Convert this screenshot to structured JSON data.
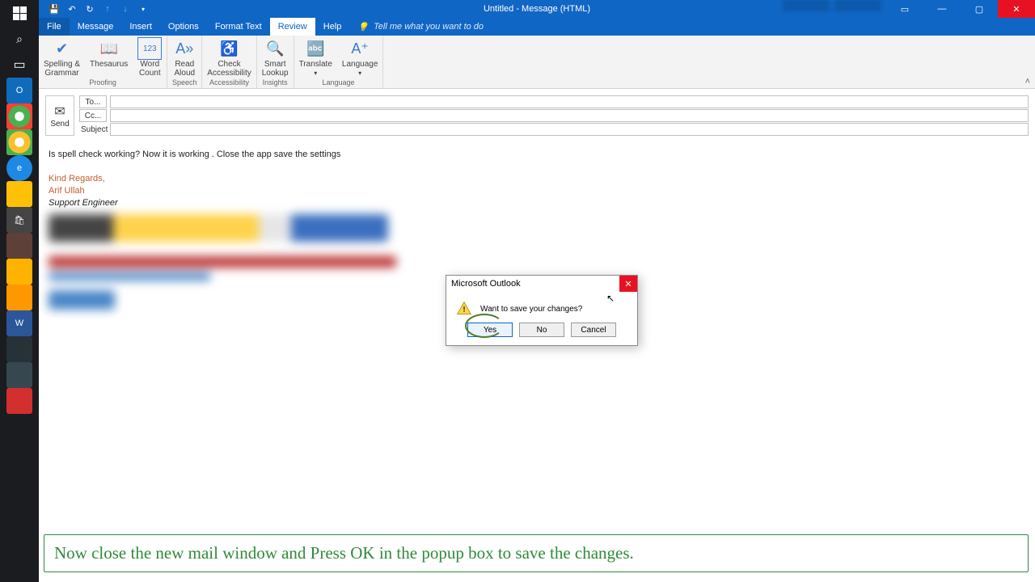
{
  "window": {
    "title": "Untitled  -  Message (HTML)"
  },
  "tabs": {
    "file": "File",
    "message": "Message",
    "insert": "Insert",
    "options": "Options",
    "formatText": "Format Text",
    "review": "Review",
    "help": "Help",
    "tellme": "Tell me what you want to do"
  },
  "ribbon": {
    "proofing": {
      "label": "Proofing",
      "spelling": "Spelling &\nGrammar",
      "thesaurus": "Thesaurus",
      "wordcount": "Word\nCount"
    },
    "speech": {
      "label": "Speech",
      "readaloud": "Read\nAloud"
    },
    "accessibility": {
      "label": "Accessibility",
      "check": "Check\nAccessibility"
    },
    "insights": {
      "label": "Insights",
      "smart": "Smart\nLookup"
    },
    "language": {
      "label": "Language",
      "translate": "Translate",
      "language": "Language"
    }
  },
  "compose": {
    "send": "Send",
    "to": "To...",
    "cc": "Cc...",
    "subject": "Subject",
    "toVal": "",
    "ccVal": "",
    "subjectVal": ""
  },
  "body": {
    "line1": "Is spell check working?  Now it is working . Close the app save the settings",
    "sig1": "Kind Regards,",
    "sig2": "Arif Ullah",
    "sig3": "Support Engineer"
  },
  "dialog": {
    "title": "Microsoft Outlook",
    "message": "Want to save your changes?",
    "yes": "Yes",
    "no": "No",
    "cancel": "Cancel"
  },
  "callout": "Now close the new mail window and Press OK in the popup box to save the changes."
}
